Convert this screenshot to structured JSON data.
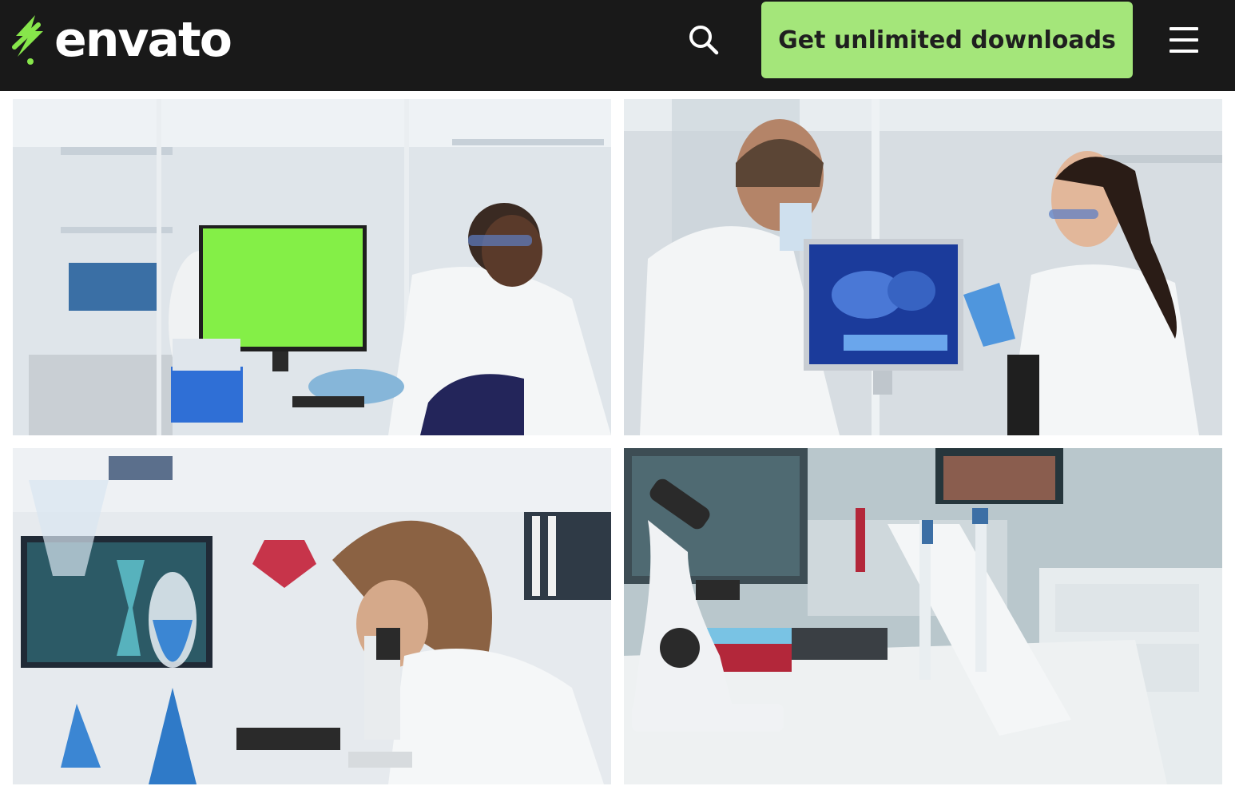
{
  "header": {
    "logo_text": "envato",
    "logo_icon": "envato-leaf-icon",
    "search_icon": "search-icon",
    "cta_label": "Get unlimited downloads",
    "menu_icon": "hamburger-menu-icon"
  },
  "colors": {
    "header_bg": "#191919",
    "cta_bg": "#a4e67a",
    "brand_green": "#87e64b"
  },
  "gallery": {
    "thumbnails": [
      {
        "image": "scientist-with-green-screen-monitor"
      },
      {
        "image": "two-scientists-analyzing-screen"
      },
      {
        "image": "scientist-using-microscope"
      },
      {
        "image": "microscope-and-pipettes-on-desk"
      }
    ]
  }
}
